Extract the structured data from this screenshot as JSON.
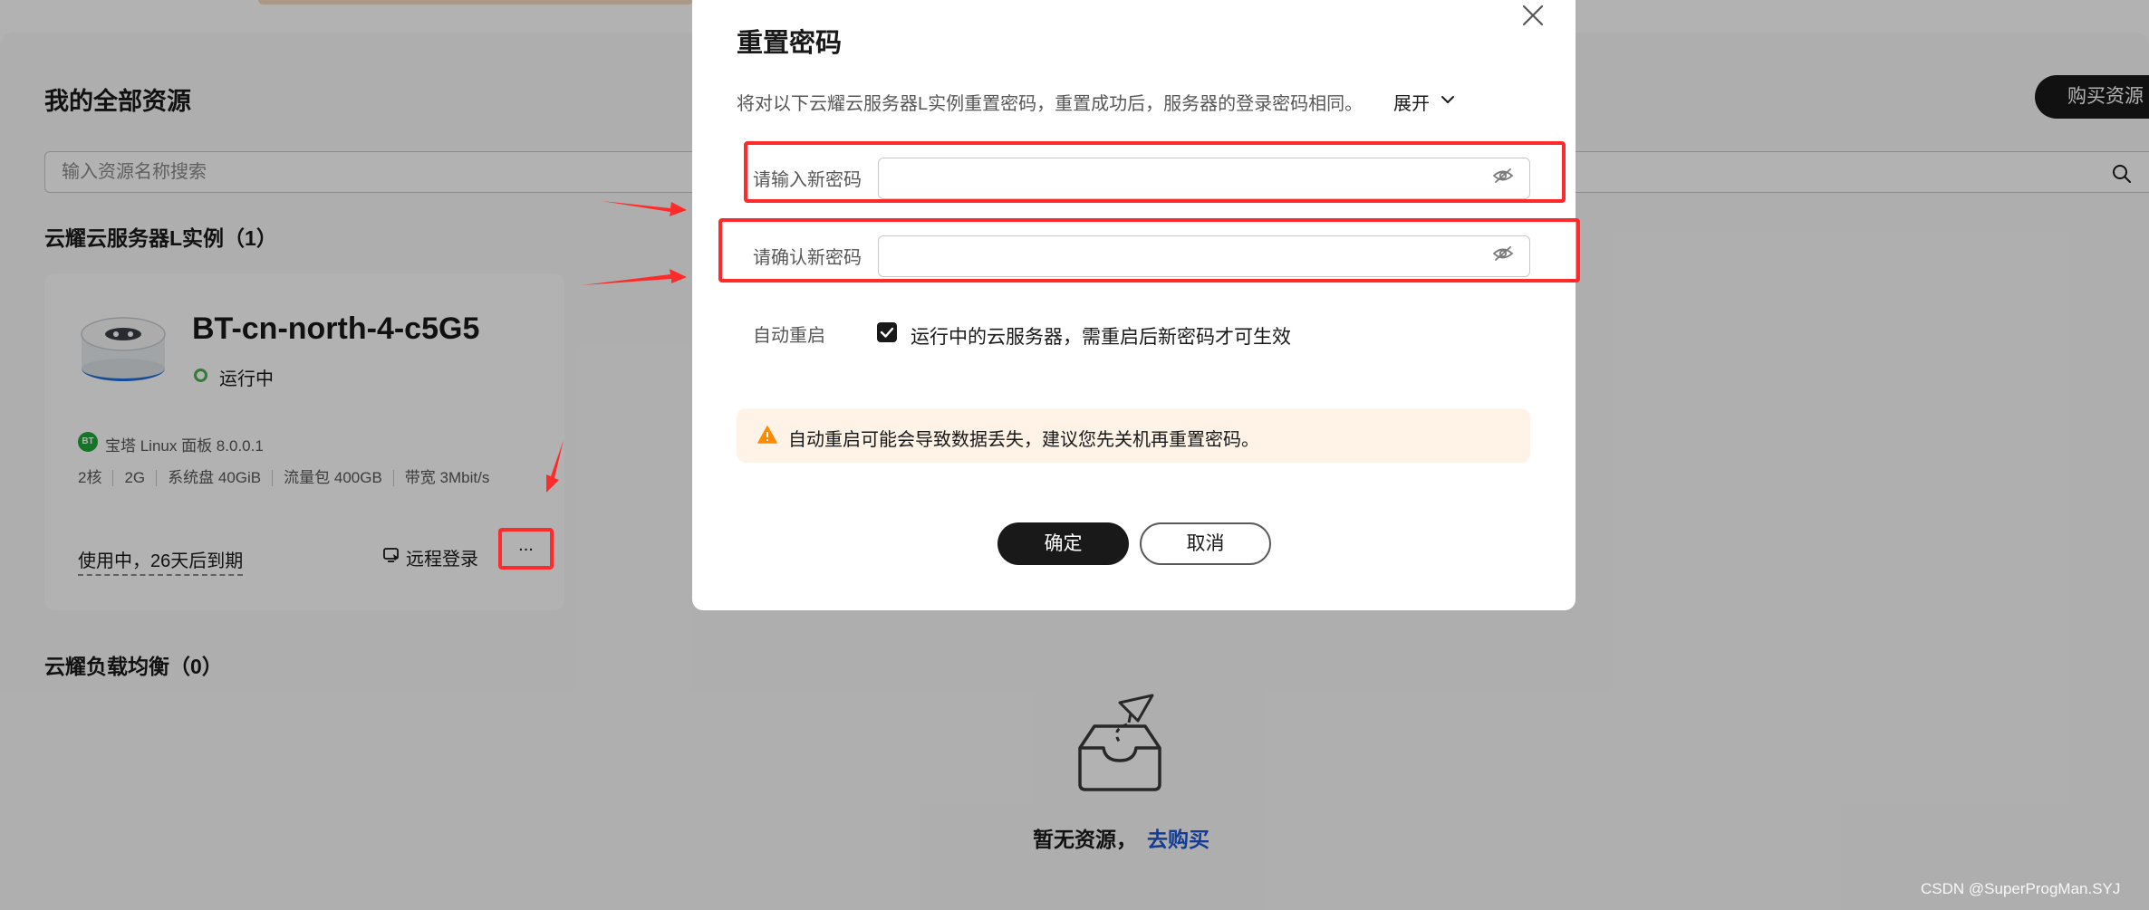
{
  "page": {
    "title": "我的全部资源",
    "buy_button": "购买资源",
    "search": {
      "placeholder": "输入资源名称搜索"
    },
    "sections": {
      "instances": "云耀云服务器L实例（1）",
      "load_balancers": "云耀负载均衡（0）"
    },
    "instance": {
      "name": "BT-cn-north-4-c5G5",
      "status": "运行中",
      "os_badge": "BT",
      "os": "宝塔 Linux 面板 8.0.0.1",
      "specs": [
        "2核",
        "2G",
        "系统盘 40GiB",
        "流量包 400GB",
        "带宽 3Mbit/s"
      ],
      "expiry": "使用中，26天后到期",
      "remote_login": "远程登录",
      "more": "..."
    },
    "empty": {
      "text": "暂无资源，",
      "link": "去购买"
    },
    "watermark": "CSDN @SuperProgMan.SYJ"
  },
  "modal": {
    "title": "重置密码",
    "description": "将对以下云耀云服务器L实例重置密码，重置成功后，服务器的登录密码相同。",
    "expand": "展开",
    "fields": [
      {
        "label": "请输入新密码",
        "value": ""
      },
      {
        "label": "请确认新密码",
        "value": ""
      }
    ],
    "auto_restart": {
      "label": "自动重启",
      "checked": true,
      "text": "运行中的云服务器，需重启后新密码才可生效"
    },
    "warning": "自动重启可能会导致数据丢失，建议您先关机再重置密码。",
    "confirm": "确定",
    "cancel": "取消"
  },
  "colors": {
    "annotation": "#ff2a2a",
    "primary": "#191919",
    "link": "#1e56d3",
    "warning": "#ff8a00",
    "status_ok": "#4caf50"
  }
}
